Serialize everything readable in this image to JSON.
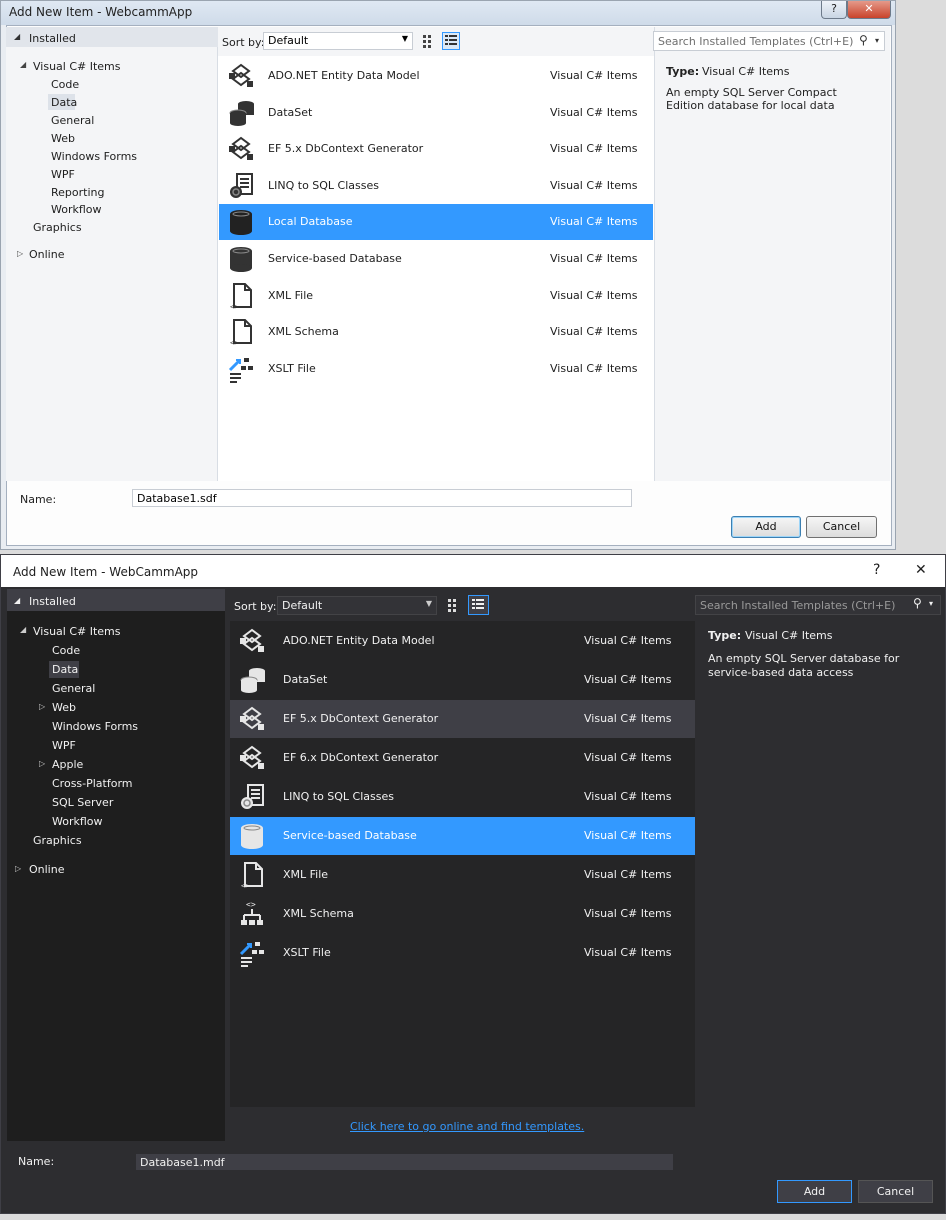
{
  "dialog1": {
    "title": "Add New Item - WebcammApp",
    "help_label": "?",
    "close_label": "✕",
    "installed_label": "Installed",
    "tree": {
      "root": "Visual C# Items",
      "children": [
        "Code",
        "Data",
        "General",
        "Web",
        "Windows Forms",
        "WPF",
        "Reporting",
        "Workflow"
      ],
      "graphics": "Graphics",
      "online": "Online"
    },
    "sort_by_label": "Sort by:",
    "sort_value": "Default",
    "search_placeholder": "Search Installed Templates (Ctrl+E)",
    "templates": [
      {
        "name": "ADO.NET Entity Data Model",
        "category": "Visual C# Items",
        "icon": "entity-model-icon"
      },
      {
        "name": "DataSet",
        "category": "Visual C# Items",
        "icon": "dataset-icon"
      },
      {
        "name": "EF 5.x DbContext Generator",
        "category": "Visual C# Items",
        "icon": "entity-model-icon"
      },
      {
        "name": "LINQ to SQL Classes",
        "category": "Visual C# Items",
        "icon": "linq-icon"
      },
      {
        "name": "Local Database",
        "category": "Visual C# Items",
        "icon": "database-icon",
        "selected": true
      },
      {
        "name": "Service-based Database",
        "category": "Visual C# Items",
        "icon": "database-icon"
      },
      {
        "name": "XML File",
        "category": "Visual C# Items",
        "icon": "xml-file-icon"
      },
      {
        "name": "XML Schema",
        "category": "Visual C# Items",
        "icon": "xml-file-icon"
      },
      {
        "name": "XSLT File",
        "category": "Visual C# Items",
        "icon": "xslt-icon"
      }
    ],
    "details": {
      "type_label": "Type:",
      "type_value": "Visual C# Items",
      "description": "An empty SQL Server Compact Edition database for local data"
    },
    "name_label": "Name:",
    "name_value": "Database1.sdf",
    "add_label": "Add",
    "cancel_label": "Cancel"
  },
  "dialog2": {
    "title": "Add New Item - WebCammApp",
    "help_label": "?",
    "close_label": "✕",
    "installed_label": "Installed",
    "tree": {
      "root": "Visual C# Items",
      "code": "Code",
      "data": "Data",
      "general": "General",
      "web": "Web",
      "windows_forms": "Windows Forms",
      "wpf": "WPF",
      "apple": "Apple",
      "cross_platform": "Cross-Platform",
      "sql_server": "SQL Server",
      "workflow": "Workflow",
      "graphics": "Graphics",
      "online": "Online"
    },
    "sort_by_label": "Sort by:",
    "sort_value": "Default",
    "search_placeholder": "Search Installed Templates (Ctrl+E)",
    "templates": [
      {
        "name": "ADO.NET Entity Data Model",
        "category": "Visual C# Items",
        "icon": "entity-model-icon"
      },
      {
        "name": "DataSet",
        "category": "Visual C# Items",
        "icon": "dataset-icon"
      },
      {
        "name": "EF 5.x DbContext Generator",
        "category": "Visual C# Items",
        "icon": "entity-model-icon",
        "hover": true
      },
      {
        "name": "EF 6.x DbContext Generator",
        "category": "Visual C# Items",
        "icon": "entity-model-icon"
      },
      {
        "name": "LINQ to SQL Classes",
        "category": "Visual C# Items",
        "icon": "linq-icon"
      },
      {
        "name": "Service-based Database",
        "category": "Visual C# Items",
        "icon": "database-icon",
        "selected": true
      },
      {
        "name": "XML File",
        "category": "Visual C# Items",
        "icon": "xml-file-icon"
      },
      {
        "name": "XML Schema",
        "category": "Visual C# Items",
        "icon": "xml-schema-icon"
      },
      {
        "name": "XSLT File",
        "category": "Visual C# Items",
        "icon": "xslt-icon"
      }
    ],
    "details": {
      "type_label": "Type:",
      "type_value": "Visual C# Items",
      "description": "An empty SQL Server database for service-based data access"
    },
    "online_link": "Click here to go online and find templates.",
    "name_label": "Name:",
    "name_value": "Database1.mdf",
    "add_label": "Add",
    "cancel_label": "Cancel"
  },
  "colors": {
    "selection": "#3399ff",
    "dark_bg": "#2d2d30",
    "dark_list": "#252526",
    "light_bg": "#f4f5f7"
  }
}
